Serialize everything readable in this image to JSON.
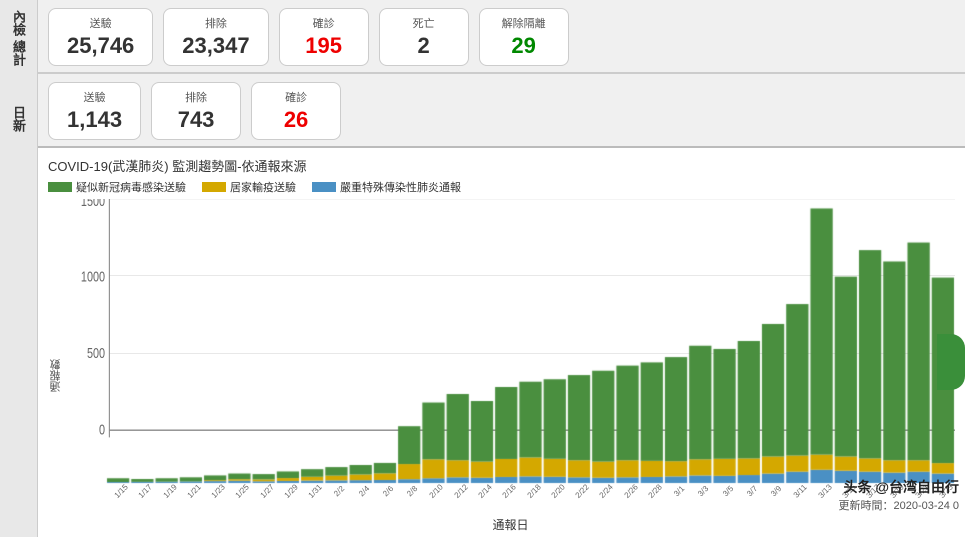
{
  "page": {
    "title": "COVID-19(武漢肺炎) 監測趨勢圖-依通報來源"
  },
  "left_labels": {
    "top": "內檢",
    "bottom": "總計",
    "daily_top": "日新"
  },
  "stats_total": {
    "label": "總計",
    "items": [
      {
        "label": "送驗",
        "value": "25,746",
        "color": "normal"
      },
      {
        "label": "排除",
        "value": "23,347",
        "color": "normal"
      },
      {
        "label": "確診",
        "value": "195",
        "color": "red"
      },
      {
        "label": "死亡",
        "value": "2",
        "color": "normal"
      },
      {
        "label": "解除隔離",
        "value": "29",
        "color": "green"
      }
    ]
  },
  "stats_daily": {
    "label": "日新",
    "items": [
      {
        "label": "送驗",
        "value": "1,143",
        "color": "normal"
      },
      {
        "label": "排除",
        "value": "743",
        "color": "normal"
      },
      {
        "label": "確診",
        "value": "26",
        "color": "red"
      }
    ]
  },
  "chart": {
    "title": "COVID-19(武漢肺炎) 監測趨勢圖-依通報來源",
    "legend": [
      {
        "label": "疑似新冠病毒感染送驗",
        "color": "#4a8f3f"
      },
      {
        "label": "居家輸疫送驗",
        "color": "#d4a800"
      },
      {
        "label": "嚴重特殊傳染性肺炎通報",
        "color": "#4a90c4"
      }
    ],
    "y_axis_label": "通報數",
    "x_axis_label": "通報日",
    "y_ticks": [
      0,
      500,
      1000,
      1500
    ],
    "x_ticks": [
      "1/15",
      "1/17",
      "1/19",
      "1/21",
      "1/23",
      "1/25",
      "1/27",
      "1/29",
      "1/31",
      "2/2",
      "2/4",
      "2/6",
      "2/8",
      "2/10",
      "2/12",
      "2/14",
      "2/16",
      "2/18",
      "2/20",
      "2/22",
      "2/24",
      "2/26",
      "2/28",
      "3/1",
      "3/3",
      "3/5",
      "3/7",
      "3/9",
      "3/11",
      "3/13",
      "3/15",
      "3/17",
      "3/19",
      "3/21",
      "3/23"
    ],
    "bars": [
      {
        "green": 20,
        "yellow": 0,
        "blue": 5
      },
      {
        "green": 15,
        "yellow": 0,
        "blue": 6
      },
      {
        "green": 18,
        "yellow": 0,
        "blue": 7
      },
      {
        "green": 22,
        "yellow": 0,
        "blue": 8
      },
      {
        "green": 25,
        "yellow": 5,
        "blue": 10
      },
      {
        "green": 30,
        "yellow": 8,
        "blue": 12
      },
      {
        "green": 28,
        "yellow": 10,
        "blue": 9
      },
      {
        "green": 35,
        "yellow": 15,
        "blue": 11
      },
      {
        "green": 40,
        "yellow": 20,
        "blue": 13
      },
      {
        "green": 45,
        "yellow": 25,
        "blue": 14
      },
      {
        "green": 50,
        "yellow": 30,
        "blue": 15
      },
      {
        "green": 55,
        "yellow": 35,
        "blue": 16
      },
      {
        "green": 200,
        "yellow": 80,
        "blue": 20
      },
      {
        "green": 300,
        "yellow": 100,
        "blue": 25
      },
      {
        "green": 350,
        "yellow": 90,
        "blue": 30
      },
      {
        "green": 320,
        "yellow": 85,
        "blue": 28
      },
      {
        "green": 380,
        "yellow": 95,
        "blue": 32
      },
      {
        "green": 400,
        "yellow": 100,
        "blue": 35
      },
      {
        "green": 420,
        "yellow": 95,
        "blue": 33
      },
      {
        "green": 450,
        "yellow": 90,
        "blue": 30
      },
      {
        "green": 480,
        "yellow": 85,
        "blue": 28
      },
      {
        "green": 500,
        "yellow": 90,
        "blue": 30
      },
      {
        "green": 520,
        "yellow": 85,
        "blue": 32
      },
      {
        "green": 550,
        "yellow": 80,
        "blue": 35
      },
      {
        "green": 600,
        "yellow": 85,
        "blue": 40
      },
      {
        "green": 580,
        "yellow": 90,
        "blue": 38
      },
      {
        "green": 620,
        "yellow": 88,
        "blue": 42
      },
      {
        "green": 700,
        "yellow": 90,
        "blue": 50
      },
      {
        "green": 800,
        "yellow": 85,
        "blue": 60
      },
      {
        "green": 1300,
        "yellow": 80,
        "blue": 70
      },
      {
        "green": 950,
        "yellow": 75,
        "blue": 65
      },
      {
        "green": 1100,
        "yellow": 70,
        "blue": 60
      },
      {
        "green": 1050,
        "yellow": 65,
        "blue": 55
      },
      {
        "green": 1150,
        "yellow": 60,
        "blue": 60
      },
      {
        "green": 980,
        "yellow": 55,
        "blue": 50
      }
    ]
  },
  "watermark": {
    "site": "头条 @台湾自由行",
    "time": "更新時間：2020-03-24 0"
  }
}
